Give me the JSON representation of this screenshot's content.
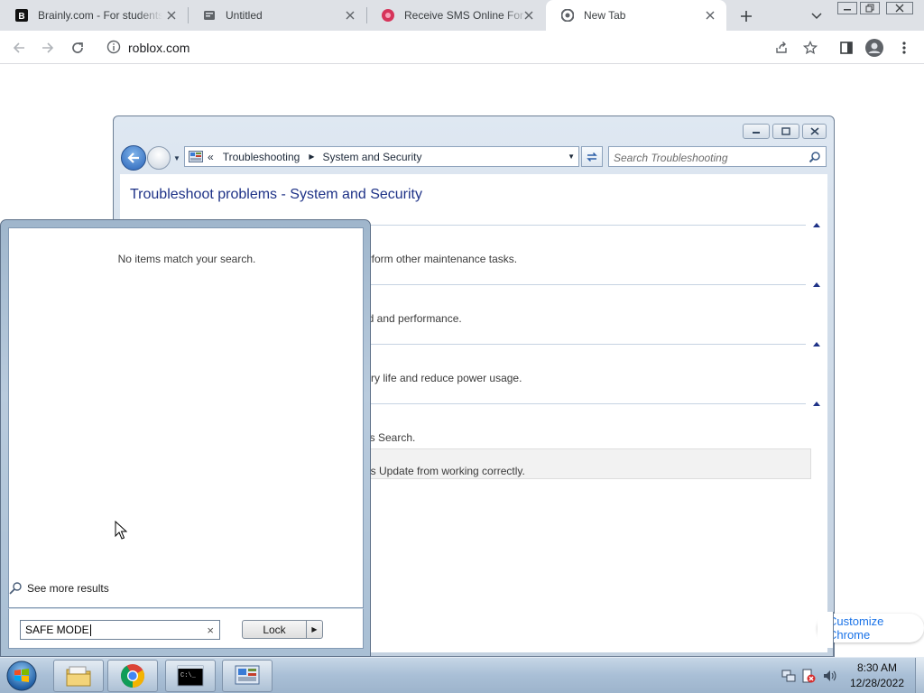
{
  "browser": {
    "tabs": [
      {
        "title": "Brainly.com - For students",
        "favicon": "brainly-logo",
        "active": false
      },
      {
        "title": "Untitled",
        "favicon": "document-icon",
        "active": false
      },
      {
        "title": "Receive SMS Online For Free",
        "favicon": "sms-site-logo",
        "active": false
      },
      {
        "title": "New Tab",
        "favicon": "chrome-icon",
        "active": true
      }
    ],
    "address": "roblox.com",
    "customize_label": "Customize Chrome"
  },
  "control_panel": {
    "breadcrumb": [
      "Troubleshooting",
      "System and Security"
    ],
    "breadcrumb_prefix": "«",
    "search_placeholder": "Search Troubleshooting",
    "heading": "Troubleshoot problems - System and Security",
    "sections": [
      {
        "description_visible": "erform other maintenance tasks."
      },
      {
        "description_visible": "ed and performance."
      },
      {
        "description_visible": "tery life and reduce power usage."
      },
      {
        "description_visible": "ws Search."
      }
    ],
    "hovered_item_text": "ws Update from working correctly."
  },
  "start_menu": {
    "no_results": "No items match your search.",
    "see_more": "See more results",
    "search_value": "SAFE MODE",
    "clear_symbol": "×",
    "lock_label": "Lock",
    "power_arrow": "▶"
  },
  "taskbar": {
    "items": [
      "windows-explorer",
      "google-chrome",
      "command-prompt",
      "control-panel"
    ],
    "time": "8:30 AM",
    "date": "12/28/2022"
  }
}
